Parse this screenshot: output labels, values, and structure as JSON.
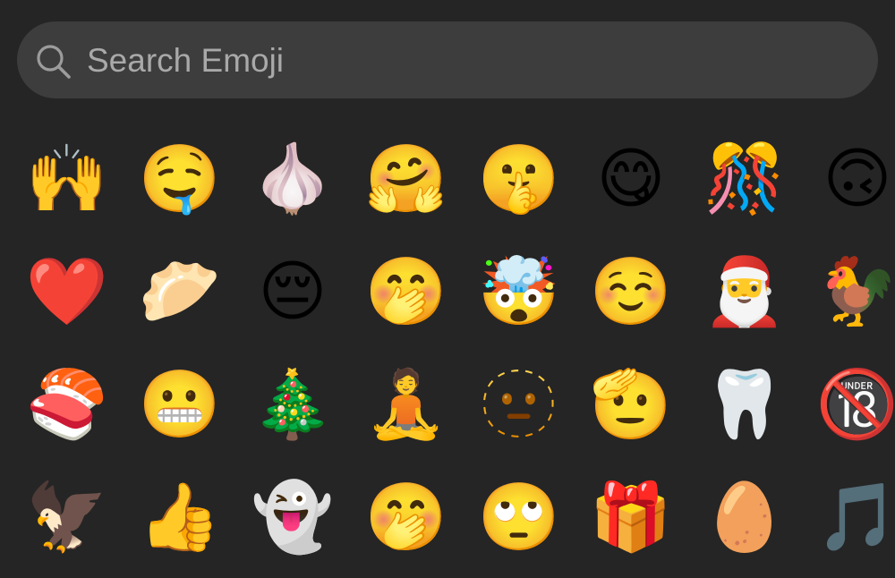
{
  "search": {
    "placeholder": "Search Emoji",
    "icon": "search-icon",
    "placeholder_color": "#a9a9a9",
    "background_color": "#3d3d3d"
  },
  "page": {
    "background_color": "#252525"
  },
  "emojis": [
    [
      {
        "char": "🙌",
        "name": "raising-hands"
      },
      {
        "char": "🤤",
        "name": "drooling-face"
      },
      {
        "char": "🧄",
        "name": "garlic-sticker"
      },
      {
        "char": "🤗",
        "name": "hugging-face"
      },
      {
        "char": "🤫",
        "name": "shushing-face"
      },
      {
        "char": "😋",
        "name": "face-savoring-food"
      },
      {
        "char": "🎊",
        "name": "confetti-ball"
      },
      {
        "char": "🙃",
        "name": "upside-down-face"
      }
    ],
    [
      {
        "char": "❤️",
        "name": "red-heart"
      },
      {
        "char": "🥟",
        "name": "dumpling-sticker"
      },
      {
        "char": "😔",
        "name": "pensive-face"
      },
      {
        "char": "🤭",
        "name": "face-with-hand-over-mouth"
      },
      {
        "char": "🤯",
        "name": "exploding-head-skull"
      },
      {
        "char": "☺️",
        "name": "smiling-face"
      },
      {
        "char": "🎅",
        "name": "santa-claus"
      },
      {
        "char": "🐓",
        "name": "rooster"
      }
    ],
    [
      {
        "char": "🍣",
        "name": "sushi-roll-sticker"
      },
      {
        "char": "😬",
        "name": "grimacing-face"
      },
      {
        "char": "🎄",
        "name": "christmas-tree"
      },
      {
        "char": "🧘",
        "name": "monk-sticker"
      },
      {
        "char": "🫥",
        "name": "dotted-line-face"
      },
      {
        "char": "🫡",
        "name": "saluting-face"
      },
      {
        "char": "🦷",
        "name": "tooth"
      },
      {
        "char": "🔞",
        "name": "no-one-under-eighteen"
      }
    ],
    [
      {
        "char": "🦅",
        "name": "eagle-sticker"
      },
      {
        "char": "👍",
        "name": "thumbs-up"
      },
      {
        "char": "👻",
        "name": "ghost"
      },
      {
        "char": "🤭",
        "name": "face-with-hand-over-mouth-2"
      },
      {
        "char": "🙄",
        "name": "face-with-rolling-eyes"
      },
      {
        "char": "🎁",
        "name": "wrapped-gift"
      },
      {
        "char": "🥚",
        "name": "egg"
      },
      {
        "char": "🎵",
        "name": "musical-note"
      }
    ]
  ]
}
